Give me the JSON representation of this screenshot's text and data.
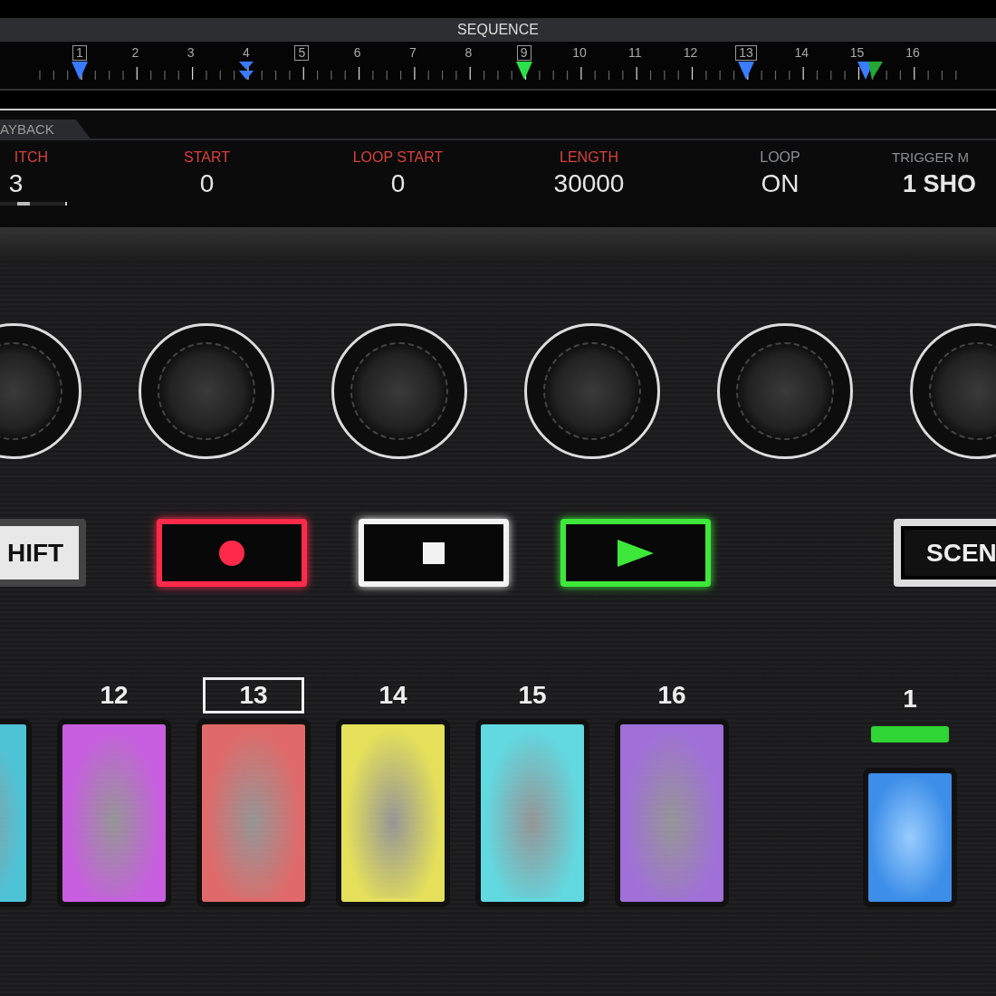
{
  "sequence": {
    "title": "SEQUENCE",
    "steps": [
      {
        "label": "1",
        "boxed": true,
        "markers": [
          {
            "kind": "cue"
          }
        ]
      },
      {
        "label": "2",
        "boxed": false
      },
      {
        "label": "3",
        "boxed": false
      },
      {
        "label": "4",
        "boxed": false,
        "markers": [
          {
            "kind": "double"
          }
        ]
      },
      {
        "label": "5",
        "boxed": true
      },
      {
        "label": "6",
        "boxed": false
      },
      {
        "label": "7",
        "boxed": false
      },
      {
        "label": "8",
        "boxed": false
      },
      {
        "label": "9",
        "boxed": true,
        "markers": [
          {
            "kind": "loop"
          }
        ]
      },
      {
        "label": "10",
        "boxed": false
      },
      {
        "label": "11",
        "boxed": false
      },
      {
        "label": "12",
        "boxed": false
      },
      {
        "label": "13",
        "boxed": true,
        "markers": [
          {
            "kind": "cue"
          }
        ]
      },
      {
        "label": "14",
        "boxed": false
      },
      {
        "label": "15",
        "boxed": false,
        "markers": [
          {
            "kind": "pair"
          }
        ]
      },
      {
        "label": "16",
        "boxed": false
      }
    ]
  },
  "playback": {
    "tab": "AYBACK",
    "params": [
      {
        "label": "ITCH",
        "value": "3",
        "color": "#d9423c",
        "level": 0.65
      },
      {
        "label": "START",
        "value": "0",
        "color": "#d9423c"
      },
      {
        "label": "LOOP START",
        "value": "0",
        "color": "#d9423c"
      },
      {
        "label": "LENGTH",
        "value": "30000",
        "color": "#d9423c"
      },
      {
        "label": "LOOP",
        "value": "ON",
        "color": "#8a8f96"
      },
      {
        "label": "TRIGGER M",
        "value": "1 SHO",
        "color": "#8a8f96"
      }
    ]
  },
  "transport": [
    {
      "kind": "text",
      "label": "HIFT"
    },
    {
      "kind": "record",
      "color": "#ff2a4a"
    },
    {
      "kind": "stop",
      "color": "#f2f2f2"
    },
    {
      "kind": "play",
      "color": "#3ee83a"
    },
    {
      "kind": "text",
      "label": "SCEN"
    }
  ],
  "pads": [
    {
      "color": "#4fc3d6",
      "selected": false
    },
    {
      "label": "12",
      "color": "#c85ee0",
      "selected": false
    },
    {
      "label": "13",
      "color": "#e06a6a",
      "selected": true
    },
    {
      "label": "14",
      "color": "#e4e05a",
      "selected": false
    },
    {
      "label": "15",
      "color": "#62d8e0",
      "selected": false
    },
    {
      "label": "16",
      "color": "#a070d8",
      "selected": false
    }
  ],
  "scene": {
    "label": "1",
    "indicator": {
      "color": "#2fd635"
    },
    "color": "#3c8ee8"
  }
}
